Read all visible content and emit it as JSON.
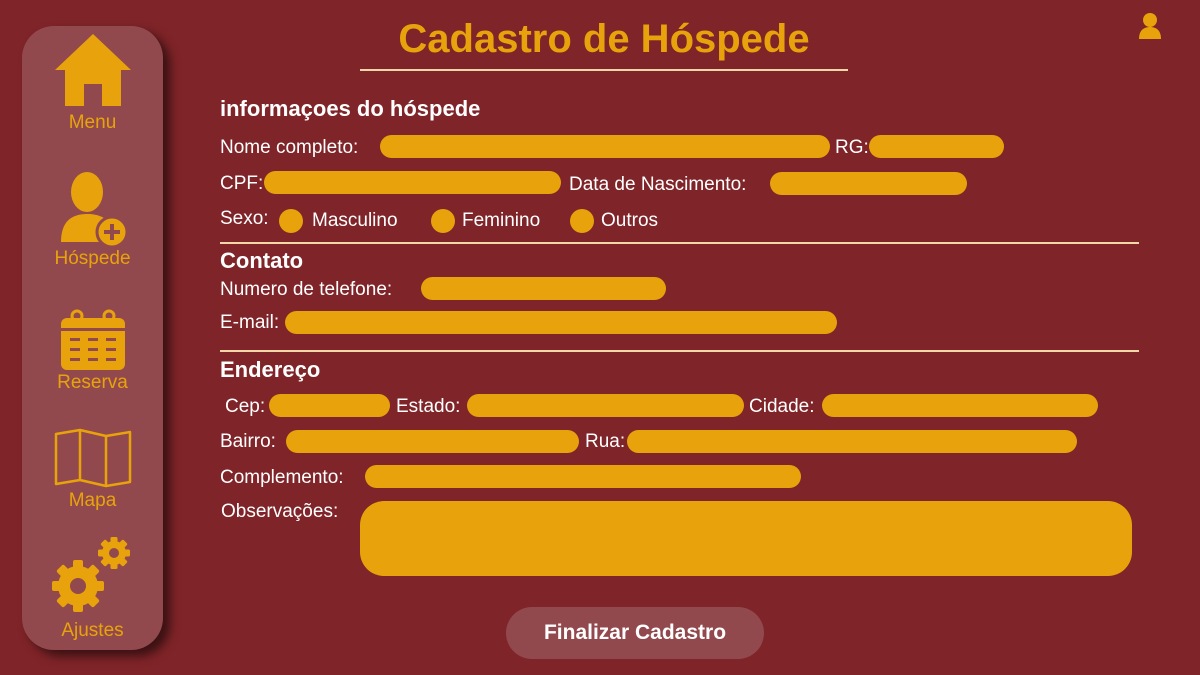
{
  "colors": {
    "background": "#7f2428",
    "sidebar": "#92494d",
    "accent": "#e8a30c",
    "rule": "#f3d7a6"
  },
  "sidebar": {
    "items": [
      {
        "label": "Menu",
        "icon": "home-icon"
      },
      {
        "label": "Hóspede",
        "icon": "add-user-icon"
      },
      {
        "label": "Reserva",
        "icon": "calendar-icon"
      },
      {
        "label": "Mapa",
        "icon": "map-icon"
      },
      {
        "label": "Ajustes",
        "icon": "gears-icon"
      }
    ]
  },
  "header": {
    "title": "Cadastro de Hóspede",
    "user_icon": "user-icon"
  },
  "guest_info": {
    "title": "informaçoes do hóspede",
    "full_name_label": "Nome completo:",
    "rg_label": "RG:",
    "cpf_label": "CPF:",
    "birth_label": "Data de Nascimento:",
    "sex_label": "Sexo:",
    "sex_options": [
      "Masculino",
      "Feminino",
      "Outros"
    ]
  },
  "contact": {
    "title": "Contato",
    "phone_label": "Numero de telefone:",
    "email_label": "E-mail:"
  },
  "address": {
    "title": "Endereço",
    "cep_label": "Cep:",
    "state_label": "Estado:",
    "city_label": "Cidade:",
    "district_label": "Bairro:",
    "street_label": "Rua:",
    "complement_label": "Complemento:",
    "notes_label": "Observações:"
  },
  "submit_label": "Finalizar Cadastro"
}
